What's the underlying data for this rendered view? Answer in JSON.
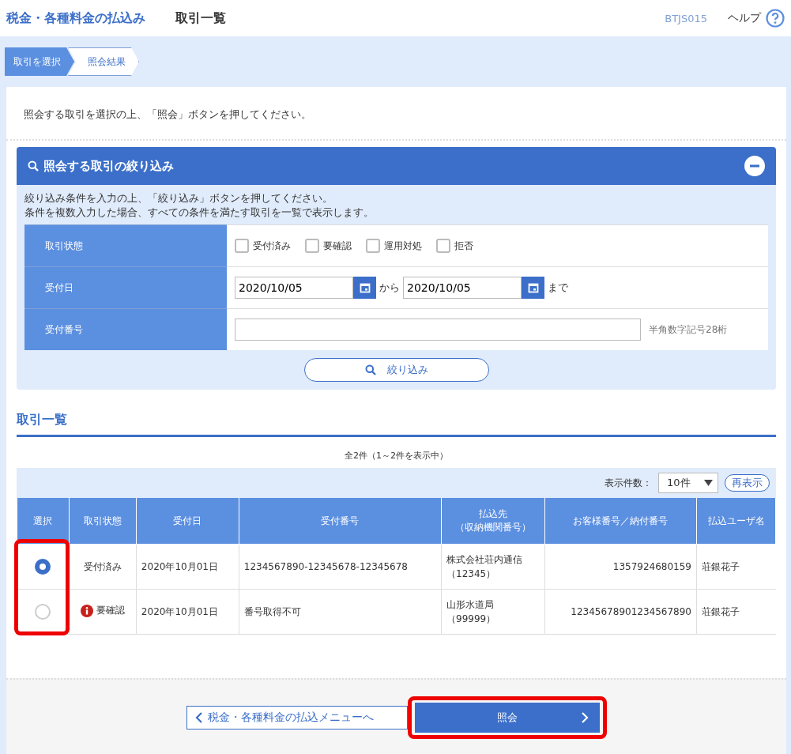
{
  "header": {
    "service_title": "税金・各種料金の払込み",
    "page_title": "取引一覧",
    "screen_id": "BTJS015",
    "help": "ヘルプ"
  },
  "steps": [
    {
      "label": "取引を選択",
      "selected": true
    },
    {
      "label": "照会結果",
      "selected": false
    }
  ],
  "instruction": "照会する取引を選択の上、「照会」ボタンを押してください。",
  "filter": {
    "title": "照会する取引の絞り込み",
    "expanded": true,
    "notes": [
      "絞り込み条件を入力の上、「絞り込み」ボタンを押してください。",
      "条件を複数入力した場合、すべての条件を満たす取引を一覧で表示します。"
    ],
    "rows": [
      {
        "kind": "checkboxes",
        "label": "取引状態",
        "options": [
          {
            "label": "受付済み",
            "checked": false
          },
          {
            "label": "要確認",
            "checked": false
          },
          {
            "label": "運用対処",
            "checked": false
          },
          {
            "label": "拒否",
            "checked": false
          }
        ]
      },
      {
        "kind": "daterange",
        "label": "受付日",
        "from": "2020/10/05",
        "between": "から",
        "to": "2020/10/05",
        "after": "まで"
      },
      {
        "kind": "text",
        "label": "受付番号",
        "value": "",
        "hint": "半角数字記号28桁"
      }
    ],
    "button": "絞り込み"
  },
  "list": {
    "title": "取引一覧",
    "count": "全2件（1～2件を表示中）",
    "page_size_label": "表示件数：",
    "page_size": "10件",
    "refresh": "再表示",
    "columns": [
      [
        "選択"
      ],
      [
        "取引状態"
      ],
      [
        "受付日"
      ],
      [
        "受付番号"
      ],
      [
        "払込先",
        "（収納機関番号）"
      ],
      [
        "お客様番号／納付番号"
      ],
      [
        "払込ユーザ名"
      ]
    ],
    "select_highlighted": true,
    "rows": [
      {
        "selected": true,
        "status": "受付済み",
        "warning": false,
        "date": "2020年10月01日",
        "number": "1234567890-12345678-12345678",
        "payee": "株式会社荘内通信",
        "payee_code": "（12345）",
        "customer_number": "1357924680159",
        "user": "荘銀花子"
      },
      {
        "selected": false,
        "status": "要確認",
        "warning": true,
        "date": "2020年10月01日",
        "number": "番号取得不可",
        "payee": "山形水道局",
        "payee_code": "（99999）",
        "customer_number": "12345678901234567890",
        "user": "荘銀花子"
      }
    ]
  },
  "footer": {
    "back": "税金・各種料金の払込メニューへ",
    "submit": "照会",
    "submit_highlighted": true
  }
}
